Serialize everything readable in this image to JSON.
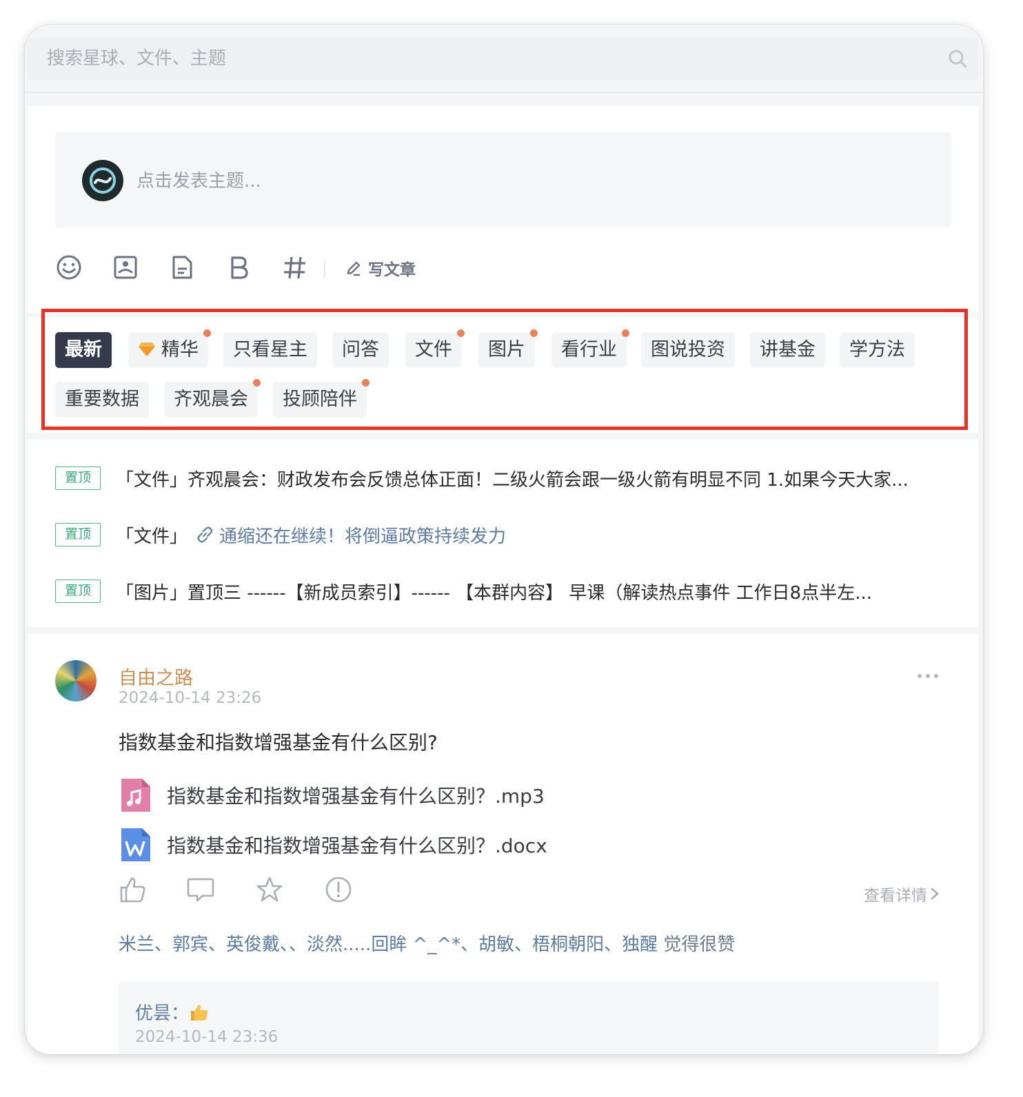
{
  "search": {
    "placeholder": "搜索星球、文件、主题"
  },
  "composer": {
    "placeholder": "点击发表主题...",
    "write_article": "写文章"
  },
  "tabs": [
    {
      "label": "最新",
      "active": true,
      "dot": false
    },
    {
      "label": "精华",
      "active": false,
      "dot": true,
      "icon": "gem-icon"
    },
    {
      "label": "只看星主",
      "active": false,
      "dot": false
    },
    {
      "label": "问答",
      "active": false,
      "dot": false
    },
    {
      "label": "文件",
      "active": false,
      "dot": true
    },
    {
      "label": "图片",
      "active": false,
      "dot": true
    },
    {
      "label": "看行业",
      "active": false,
      "dot": true
    },
    {
      "label": "图说投资",
      "active": false,
      "dot": false
    },
    {
      "label": "讲基金",
      "active": false,
      "dot": false
    },
    {
      "label": "学方法",
      "active": false,
      "dot": false
    },
    {
      "label": "重要数据",
      "active": false,
      "dot": false
    },
    {
      "label": "齐观晨会",
      "active": false,
      "dot": true
    },
    {
      "label": "投顾陪伴",
      "active": false,
      "dot": true
    }
  ],
  "pinned": {
    "badge": "置顶",
    "items": [
      {
        "prefix": "「文件」",
        "text": "齐观晨会：财政发布会反馈总体正面！二级火箭会跟一级火箭有明显不同 1.如果今天大家..."
      },
      {
        "prefix": "「文件」",
        "link": "通缩还在继续！将倒逼政策持续发力"
      },
      {
        "prefix": "「图片」",
        "text": "置顶三 ------【新成员索引】------ 【本群内容】 早课（解读热点事件 工作日8点半左..."
      }
    ]
  },
  "post": {
    "author": "自由之路",
    "time": "2024-10-14 23:26",
    "title": "指数基金和指数增强基金有什么区别?",
    "files": [
      {
        "name": "指数基金和指数增强基金有什么区别？.mp3",
        "icon": "audio-file-icon"
      },
      {
        "name": "指数基金和指数增强基金有什么区别？.docx",
        "icon": "word-file-icon"
      }
    ],
    "view_detail": "查看详情",
    "likes_names": "米兰、郭宾、英俊戴、、淡然.....回眸 ^_^*、胡敏、梧桐朝阳、独醒",
    "likes_suffix": " 觉得很赞",
    "comment": {
      "author": "优昙：",
      "time": "2024-10-14 23:36"
    }
  },
  "colors": {
    "active_tab": "#343a4b",
    "dot": "#e8825b",
    "pin_badge": "#3aa979",
    "author": "#c88e55",
    "link": "#5d7c9e",
    "highlight_box": "#e53329"
  }
}
